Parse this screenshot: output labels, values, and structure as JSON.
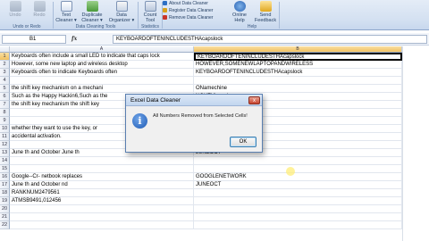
{
  "ribbon": {
    "undo": "Undo",
    "redo": "Redo",
    "text_cleaner": "Text Cleaner ▾",
    "duplicate_cleaner": "Duplicate Cleaner ▾",
    "data_organizer": "Data Organizer ▾",
    "count_tool": "Count Tool",
    "online_help": "Online Help",
    "send_feedback": "Send Feedback",
    "group_undo_redo": "Undo or Redo",
    "group_data_cleaning": "Data Cleaning Tools",
    "group_statistics": "Statistics",
    "group_help": "Help",
    "mini_items": [
      "About Data Cleaner",
      "Register Data Cleaner",
      "Remove Data Cleaner"
    ]
  },
  "formula_bar": {
    "name_box": "B1",
    "fx": "fx",
    "formula": "KEYBOARDOFTENINCLUDESTHAcapslock"
  },
  "columns": [
    "A",
    "B"
  ],
  "rows": [
    {
      "n": "1",
      "a": "Keyboards often include a small LED to indicate that caps lock",
      "b": "KEYBOARDOFTENINCLUDESTHAcapslock"
    },
    {
      "n": "2",
      "a": "However, some new laptop and wireless desktop",
      "b": "HOWEVER,SOMENEWLAPTOPANDWIRELESS"
    },
    {
      "n": "3",
      "a": "Keyboards often to indicate Keyboards often",
      "b": "KEYBOARDOFTENINCLUDESTHAcapslock"
    },
    {
      "n": "4",
      "a": "",
      "b": ""
    },
    {
      "n": "5",
      "a": "the shift key mechanism on a mechani",
      "b": "ONamechine"
    },
    {
      "n": "6",
      "a": "Such as the Happy Hackin6,Such as the",
      "b": "NGKEYboard"
    },
    {
      "n": "7",
      "a": "the shift key mechanism the shift key",
      "b": "ONAMECHINE"
    },
    {
      "n": "8",
      "a": "",
      "b": ""
    },
    {
      "n": "9",
      "a": "",
      "b": ""
    },
    {
      "n": "10",
      "a": " whether they want to use the key, or",
      "b": ""
    },
    {
      "n": "11",
      "a": "accidental activation.",
      "b": ""
    },
    {
      "n": "12",
      "a": "",
      "b": ""
    },
    {
      "n": "13",
      "a": "June th and October June th",
      "b": "JUNEOCT"
    },
    {
      "n": "14",
      "a": "",
      "b": ""
    },
    {
      "n": "15",
      "a": "",
      "b": ""
    },
    {
      "n": "16",
      "a": " Google--Cr- netbook replaces",
      "b": "GOOGLENETWORK"
    },
    {
      "n": "17",
      "a": "June th and October nd",
      "b": "JUNEOCT"
    },
    {
      "n": "18",
      "a": "RANKNUM2479561",
      "b": ""
    },
    {
      "n": "19",
      "a": "ATMSB9491,012456",
      "b": ""
    },
    {
      "n": "20",
      "a": "",
      "b": ""
    },
    {
      "n": "21",
      "a": "",
      "b": ""
    },
    {
      "n": "22",
      "a": "",
      "b": ""
    }
  ],
  "dialog": {
    "title": "Excel Data Cleaner",
    "close": "x",
    "message": "All Numbers Removed from Selected Cells!",
    "ok": "OK",
    "icon": "info-icon"
  }
}
